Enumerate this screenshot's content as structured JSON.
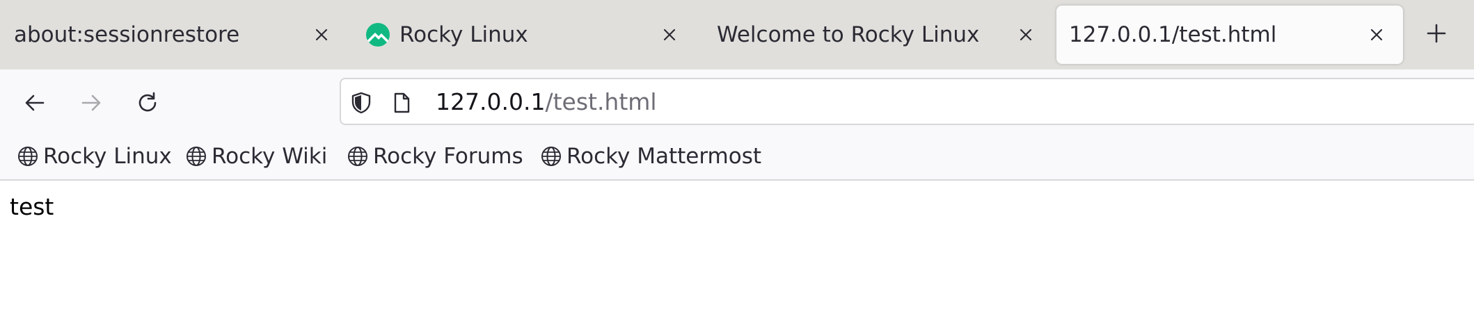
{
  "tabs": [
    {
      "title": "about:sessionrestore",
      "active": false,
      "has_favicon": false
    },
    {
      "title": "Rocky Linux",
      "active": false,
      "has_favicon": true,
      "favicon": "rocky-linux-logo-icon"
    },
    {
      "title": "Welcome to Rocky Linux",
      "active": false,
      "has_favicon": false
    },
    {
      "title": "127.0.0.1/test.html",
      "active": true,
      "has_favicon": false
    }
  ],
  "toolbar": {
    "back_icon": "back-arrow-icon",
    "forward_icon": "forward-arrow-icon",
    "reload_icon": "reload-icon",
    "new_tab_icon": "plus-icon"
  },
  "urlbar": {
    "host": "127.0.0.1",
    "path": "/test.html",
    "security_icon": "shield-icon",
    "page_icon": "page-icon"
  },
  "bookmarks": [
    {
      "label": "Rocky Linux",
      "icon": "globe-icon"
    },
    {
      "label": "Rocky Wiki",
      "icon": "globe-icon"
    },
    {
      "label": "Rocky Forums",
      "icon": "globe-icon"
    },
    {
      "label": "Rocky Mattermost",
      "icon": "globe-icon"
    }
  ],
  "page": {
    "body_text": "test"
  },
  "colors": {
    "tabstrip_bg": "#e0dfdc",
    "toolbar_bg": "#f9f9fb",
    "rocky_green": "#10b981",
    "text": "#2b2a33",
    "url_path": "#6e6d76"
  }
}
